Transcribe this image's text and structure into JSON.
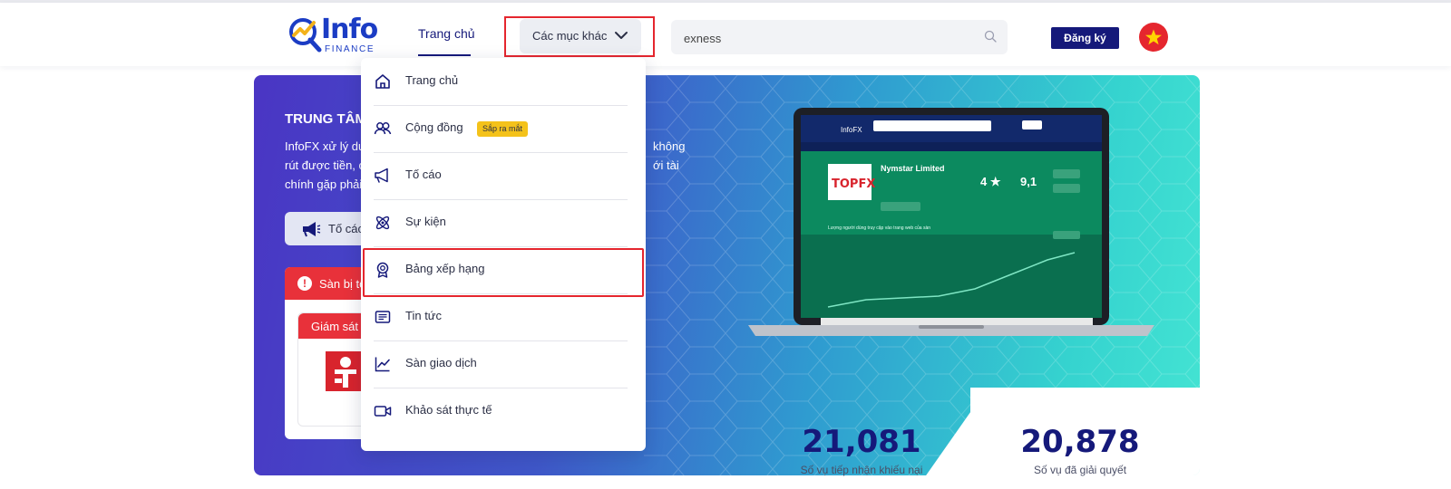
{
  "header": {
    "logo_text": "Info",
    "logo_sub": "FINANCE",
    "nav_home": "Trang chủ",
    "nav_more": "Các mục khác",
    "search_value": "exness",
    "register_label": "Đăng ký"
  },
  "dropdown": {
    "items": [
      {
        "label": "Trang chủ",
        "icon": "home-icon"
      },
      {
        "label": "Cộng đồng",
        "icon": "community-icon",
        "badge": "Sắp ra mắt"
      },
      {
        "label": "Tố cáo",
        "icon": "megaphone-icon"
      },
      {
        "label": "Sự kiện",
        "icon": "atom-icon"
      },
      {
        "label": "Bảng xếp hạng",
        "icon": "award-icon"
      },
      {
        "label": "Tin tức",
        "icon": "news-icon"
      },
      {
        "label": "Sàn giao dịch",
        "icon": "chart-line-icon"
      },
      {
        "label": "Khảo sát thực tế",
        "icon": "video-icon"
      }
    ]
  },
  "hero": {
    "title": "TRUNG TÂM",
    "desc_line1": "InfoFX xử lý dứ",
    "desc_line2": "rút được tiền, c",
    "desc_line3": "chính gặp phải",
    "desc_right1": "không",
    "desc_right2": "ới tài",
    "report_button": "Tố cáo",
    "warning_head": "Sàn bị tố",
    "warning_sub": "Giám sát c"
  },
  "laptop": {
    "brand": "InfoFX",
    "broker_name": "Nymstar Limited",
    "broker_logo": "TOPFX",
    "rating": "4 ★",
    "score": "9,1",
    "chart_caption": "Lượng người dùng truy cập vào trang web của sàn"
  },
  "stats": [
    {
      "value": "21,081",
      "label": "Số vụ tiếp nhận khiếu nại"
    },
    {
      "value": "20,878",
      "label": "Số vụ đã giải quyết"
    }
  ],
  "colors": {
    "brand_navy": "#15197a",
    "highlight_red": "#e5262e",
    "badge_yellow": "#f4c21a"
  }
}
